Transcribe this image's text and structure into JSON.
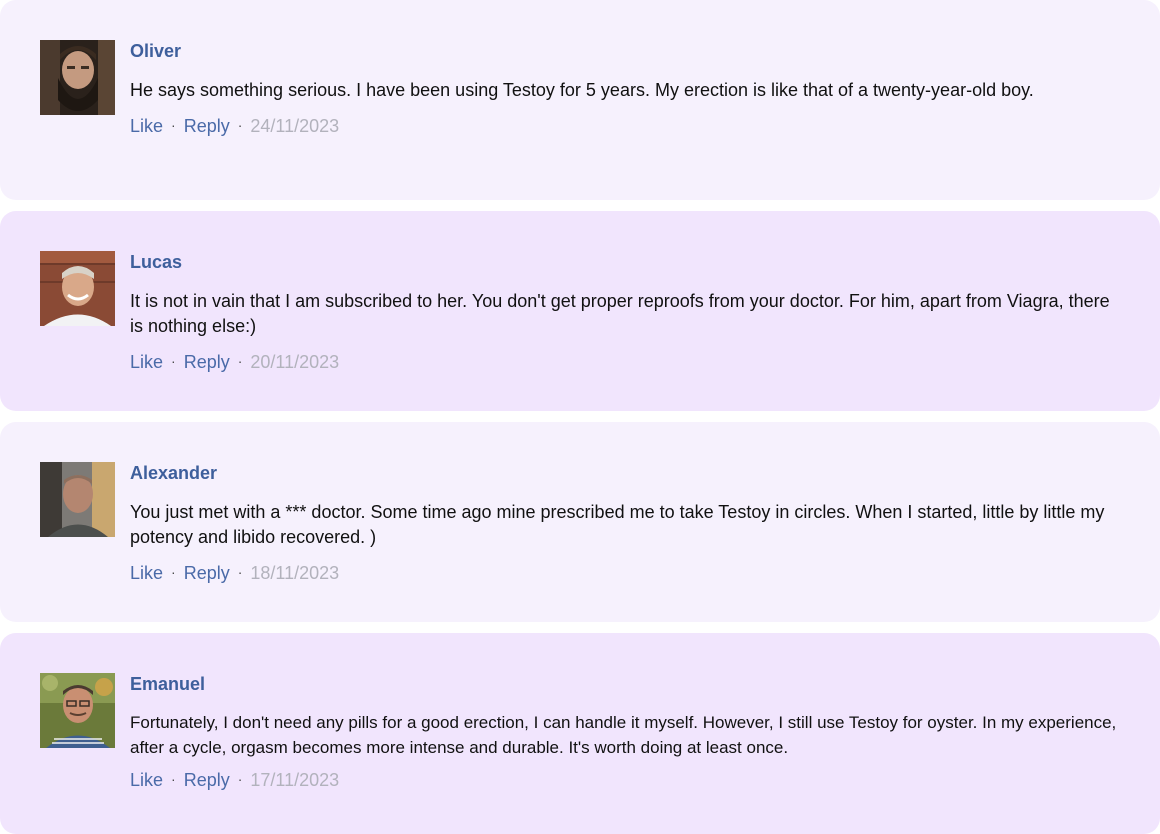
{
  "comments": [
    {
      "author": "Oliver",
      "text": "He says something serious. I have been using Testoy for 5 years. My erection is like that of a twenty-year-old boy.",
      "like_label": "Like",
      "reply_label": "Reply",
      "date": "24/11/2023"
    },
    {
      "author": "Lucas",
      "text": "It is not in vain that I am subscribed to her. You don't get proper reproofs from your doctor. For him, apart from Viagra, there is nothing else:)",
      "like_label": "Like",
      "reply_label": "Reply",
      "date": "20/11/2023"
    },
    {
      "author": "Alexander",
      "text": "You just met with a *** doctor. Some time ago mine prescribed me to take Testoy in circles. When I started, little by little my potency and libido recovered. )",
      "like_label": "Like",
      "reply_label": "Reply",
      "date": "18/11/2023"
    },
    {
      "author": "Emanuel",
      "text": "Fortunately, I don't need any pills for a good erection, I can handle it myself. However, I still use Testoy for oyster. In my experience, after a cycle, orgasm becomes more intense and durable. It's worth doing at least once.",
      "like_label": "Like",
      "reply_label": "Reply",
      "date": "17/11/2023"
    }
  ],
  "separator": "·",
  "colors": {
    "card_light": "#f6f1fd",
    "card_dark": "#f1e5fd",
    "author": "#3e5f9c",
    "link": "#4a6aa8",
    "date": "#b2b2bc"
  }
}
